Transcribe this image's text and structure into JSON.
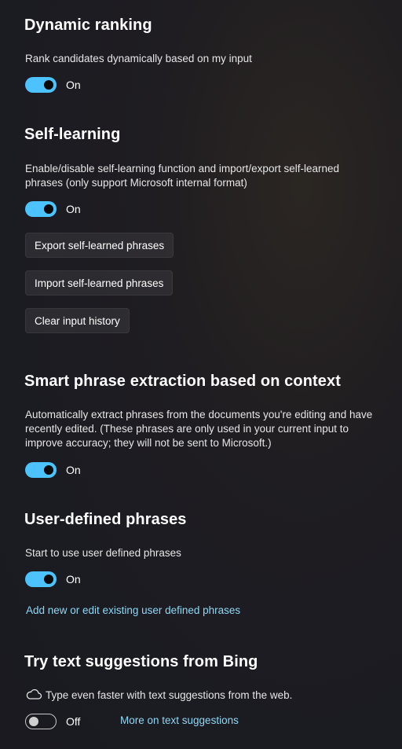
{
  "dynamic_ranking": {
    "heading": "Dynamic ranking",
    "description": "Rank candidates dynamically based on my input",
    "toggle_state": "On"
  },
  "self_learning": {
    "heading": "Self-learning",
    "description": "Enable/disable self-learning function and import/export self-learned phrases (only support Microsoft internal format)",
    "toggle_state": "On",
    "export_label": "Export self-learned phrases",
    "import_label": "Import self-learned phrases",
    "clear_label": "Clear input history"
  },
  "smart_extraction": {
    "heading": "Smart phrase extraction based on context",
    "description": "Automatically extract phrases from the documents you're editing and have recently edited. (These phrases are only used in your current input to improve accuracy; they will not be sent to Microsoft.)",
    "toggle_state": "On"
  },
  "user_defined": {
    "heading": "User-defined phrases",
    "description": "Start to use user defined phrases",
    "toggle_state": "On",
    "link": "Add new or edit existing user defined phrases"
  },
  "bing": {
    "heading": "Try text suggestions from Bing",
    "description": "Type even faster with text suggestions from the web.",
    "icon": "cloud-icon",
    "toggle_state": "Off",
    "link": "More on text suggestions"
  },
  "colors": {
    "accent": "#4cc2ff",
    "link": "#8fd8f5",
    "background": "#1c1c22"
  }
}
